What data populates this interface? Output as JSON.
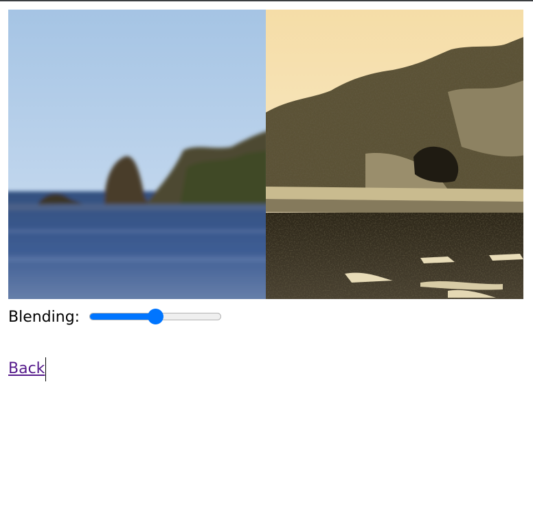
{
  "compare_view": {
    "left_image": "landscape-blurred",
    "right_image": "landscape-sepia-sketch"
  },
  "blending": {
    "label": "Blending:",
    "value": 0.5,
    "accent_color": "#0075ff"
  },
  "back_link": {
    "label": "Back",
    "color": "#551a8b"
  }
}
